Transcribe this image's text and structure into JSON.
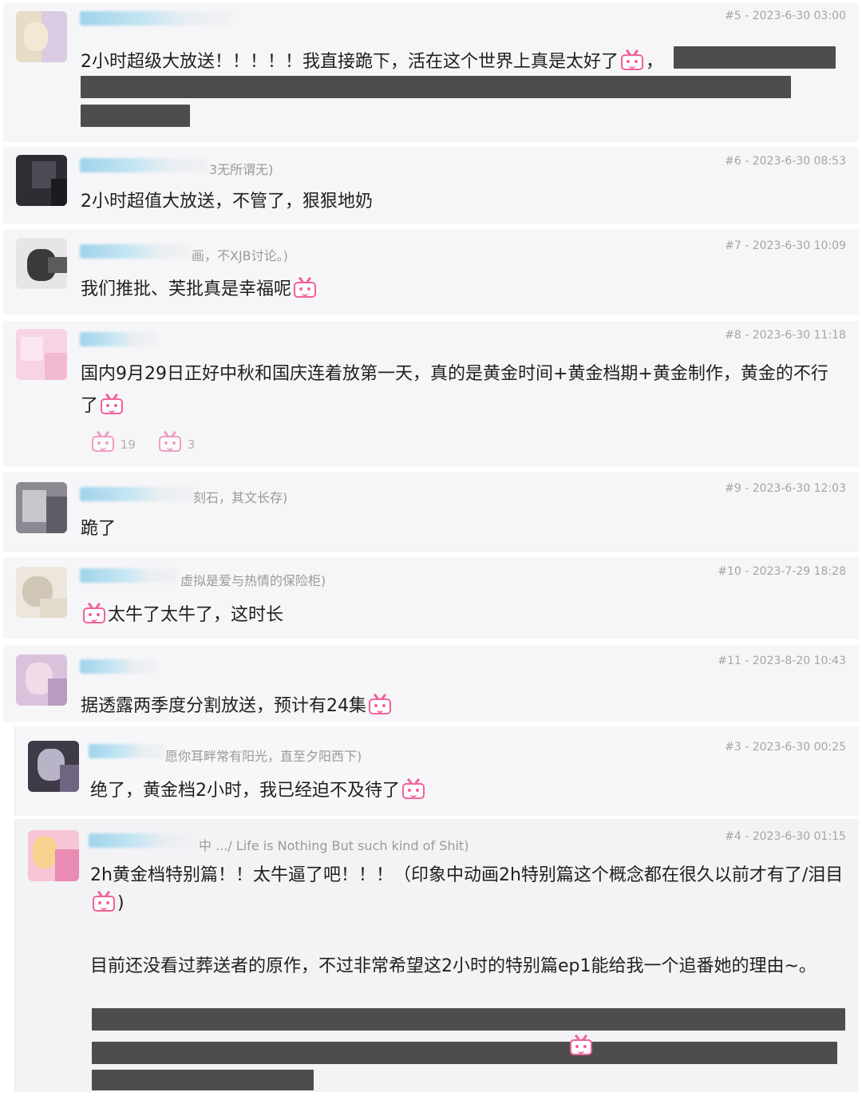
{
  "posts": [
    {
      "meta": "#5 - 2023-6-30 03:00",
      "sig": "",
      "content": "2小时超级大放送！！！！！我直接跪下，活在这个世界上真是太好了",
      "content_tail": "，"
    },
    {
      "meta": "#6 - 2023-6-30 08:53",
      "sig": "3无所谓无)",
      "content": "2小时超值大放送，不管了，狠狠地奶"
    },
    {
      "meta": "#7 - 2023-6-30 10:09",
      "sig": "画，不XJB讨论。)",
      "content": "我们推批、芙批真是幸福呢"
    },
    {
      "meta": "#8 - 2023-6-30 11:18",
      "sig": "",
      "content": "国内9月29日正好中秋和国庆连着放第一天，真的是黄金时间+黄金档期+黄金制作，黄金的不行",
      "content2": "了",
      "reactions": [
        "19",
        "3"
      ]
    },
    {
      "meta": "#9 - 2023-6-30 12:03",
      "sig": "刻石，其文长存)",
      "content": "跪了"
    },
    {
      "meta": "#10 - 2023-7-29 18:28",
      "sig": "虚拟是爱与热情的保险柜)",
      "content": "太牛了太牛了，这时长"
    },
    {
      "meta": "#11 - 2023-8-20 10:43",
      "sig": "",
      "content": "据透露两季度分割放送，预计有24集"
    }
  ],
  "replies": [
    {
      "meta": "#3 - 2023-6-30 00:25",
      "sig": "愿你耳畔常有阳光，直至夕阳西下)",
      "content": "绝了，黄金档2小时，我已经迫不及待了"
    },
    {
      "meta": "#4 - 2023-6-30 01:15",
      "sig": "中 .../ Life is Nothing But such kind of Shit)",
      "content": "2h黄金档特别篇！！太牛逼了吧！！！（印象中动画2h特别篇这个概念都在很久以前才有了/泪目",
      "content_close": ")",
      "content3": "目前还没看过葬送者的原作，不过非常希望这2小时的特别篇ep1能给我一个追番她的理由~。"
    }
  ],
  "icons": {
    "emoticon": "bilibili-tv-emoticon-icon"
  },
  "colors": {
    "accent": "#f0639a",
    "redaction": "#4d4d4d",
    "meta": "#a5a5a5"
  }
}
